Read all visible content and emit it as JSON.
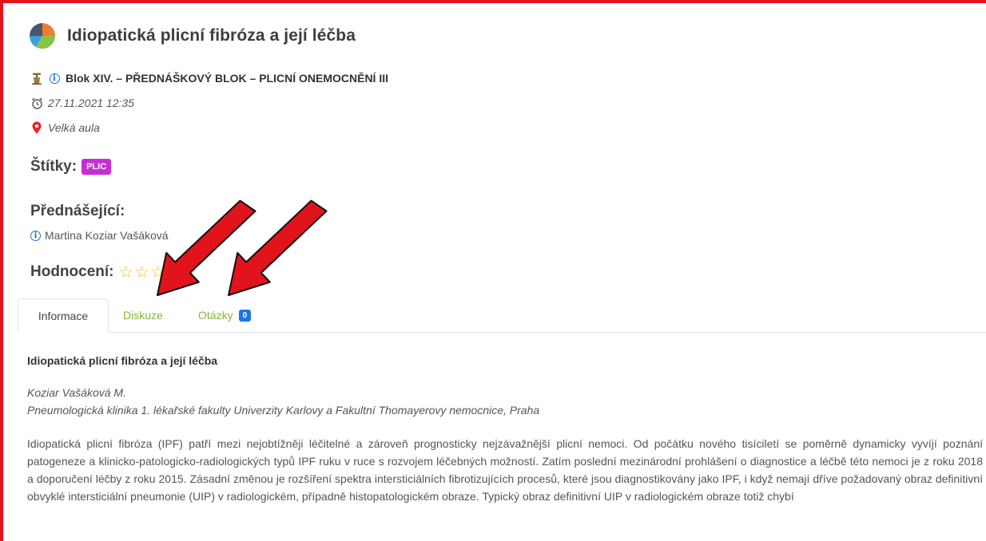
{
  "title": "Idiopatická plicní fibróza a její léčba",
  "block": "Blok XIV. – PŘEDNÁŠKOVÝ BLOK – PLICNÍ ONEMOCNĚNÍ III",
  "datetime": "27.11.2021 12:35",
  "place": "Velká aula",
  "tags": {
    "label": "Štítky:",
    "items": [
      "PLIC"
    ]
  },
  "lecturers": {
    "label": "Přednášející:",
    "items": [
      "Martina Koziar Vašáková"
    ]
  },
  "rating": {
    "label": "Hodnocení:",
    "value": 0,
    "max": 5
  },
  "tabs": [
    {
      "label": "Informace",
      "active": true
    },
    {
      "label": "Diskuze",
      "active": false
    },
    {
      "label": "Otázky",
      "count": "0",
      "active": false
    }
  ],
  "article": {
    "heading": "Idiopatická plicní fibróza a její léčba",
    "author": "Koziar Vašáková M.",
    "affiliation": "Pneumologická klinika 1. lékařské fakulty Univerzity Karlovy a Fakultní Thomayerovy nemocnice, Praha",
    "body": "Idiopatická plicní fibróza (IPF) patří mezi nejobtížněji léčitelné a zároveň prognosticky nejzávažnější plicní nemoci. Od počátku nového tisíciletí se poměrně dynamicky vyvíjí poznání patogeneze a klinicko-patologicko-radiologických typů IPF ruku v ruce s rozvojem léčebných možností. Zatím poslední mezinárodní prohlášení o diagnostice a léčbě této nemoci je z roku 2018 a doporučení léčby z roku 2015. Zásadní změnou je rozšíření spektra intersticiálních fibrotizujících procesů, které jsou diagnostikovány jako IPF, i když nemají dříve požadovaný obraz definitivní obvyklé intersticiální pneumonie (UIP) v radiologickém, případně histopatologickém obraze. Typický obraz definitivní UIP v radiologickém obraze totiž chybí"
  },
  "colors": {
    "frame": "#e3131b",
    "tag_badge": "#c62fd6",
    "tab_link": "#86b43a",
    "count_badge": "#1877e8",
    "star": "#f2c21b",
    "info_icon": "#1f6fd6",
    "location_icon": "#e5242b"
  },
  "icons": [
    "pie-chart-icon",
    "podium-icon",
    "info-icon",
    "alarm-clock-icon",
    "map-marker-icon",
    "star-outline-icon",
    "red-arrow-annotation"
  ]
}
